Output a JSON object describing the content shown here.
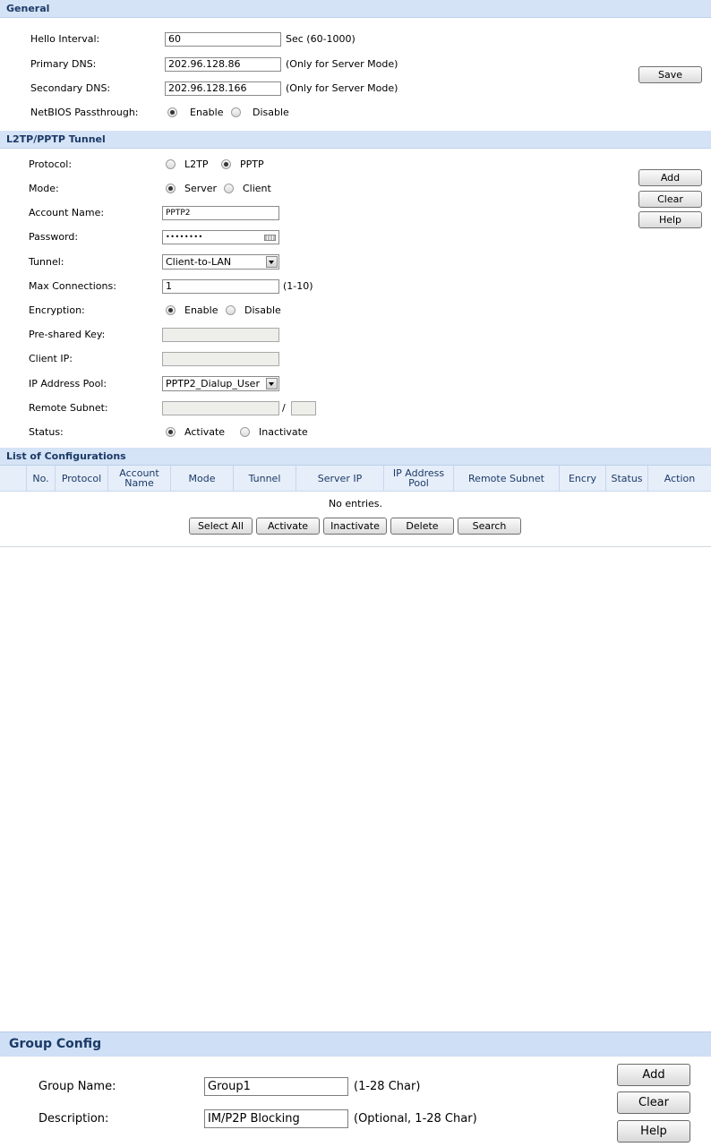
{
  "general": {
    "title": "General",
    "hello_interval": {
      "label": "Hello Interval:",
      "value": "60",
      "hint": "Sec (60-1000)"
    },
    "primary_dns": {
      "label": "Primary DNS:",
      "value": "202.96.128.86",
      "hint": "(Only for Server Mode)"
    },
    "secondary_dns": {
      "label": "Secondary DNS:",
      "value": "202.96.128.166",
      "hint": "(Only for Server Mode)"
    },
    "netbios": {
      "label": "NetBIOS Passthrough:",
      "enable": "Enable",
      "disable": "Disable",
      "selected": "Enable"
    },
    "save_label": "Save"
  },
  "tunnel": {
    "title": "L2TP/PPTP Tunnel",
    "protocol": {
      "label": "Protocol:",
      "opt1": "L2TP",
      "opt2": "PPTP",
      "selected": "PPTP"
    },
    "mode": {
      "label": "Mode:",
      "opt1": "Server",
      "opt2": "Client",
      "selected": "Server"
    },
    "account_name": {
      "label": "Account Name:",
      "value": "PPTP2"
    },
    "password": {
      "label": "Password:",
      "value": "••••••••"
    },
    "tunnel": {
      "label": "Tunnel:",
      "value": "Client-to-LAN"
    },
    "max_connections": {
      "label": "Max Connections:",
      "value": "1",
      "hint": "(1-10)"
    },
    "encryption": {
      "label": "Encryption:",
      "opt1": "Enable",
      "opt2": "Disable",
      "selected": "Enable"
    },
    "psk": {
      "label": "Pre-shared Key:",
      "value": ""
    },
    "client_ip": {
      "label": "Client IP:",
      "value": ""
    },
    "ip_pool": {
      "label": "IP Address Pool:",
      "value": "PPTP2_Dialup_User"
    },
    "remote_subnet": {
      "label": "Remote Subnet:",
      "sep": "/"
    },
    "status": {
      "label": "Status:",
      "opt1": "Activate",
      "opt2": "Inactivate",
      "selected": "Activate"
    },
    "add_label": "Add",
    "clear_label": "Clear",
    "help_label": "Help"
  },
  "list": {
    "title": "List of Configurations",
    "columns": [
      "",
      "No.",
      "Protocol",
      "Account Name",
      "Mode",
      "Tunnel",
      "Server IP",
      "IP Address Pool",
      "Remote Subnet",
      "Encry",
      "Status",
      "Action"
    ],
    "empty_text": "No entries.",
    "buttons": {
      "select_all": "Select All",
      "activate": "Activate",
      "inactivate": "Inactivate",
      "delete": "Delete",
      "search": "Search"
    }
  },
  "group_config": {
    "title": "Group Config",
    "group_name": {
      "label": "Group Name:",
      "value": "Group1",
      "hint": "(1-28 Char)"
    },
    "description": {
      "label": "Description:",
      "value": "IM/P2P Blocking",
      "hint": "(Optional, 1-28 Char)"
    },
    "add_label": "Add",
    "clear_label": "Clear",
    "help_label": "Help"
  },
  "colors": {
    "section_bar": "#d5e3f6",
    "section_title": "#1b3a66",
    "table_header": "#e6eefa"
  },
  "icons": {
    "password_keyboard": "keyboard-icon",
    "select_arrow": "chevron-down-icon"
  }
}
